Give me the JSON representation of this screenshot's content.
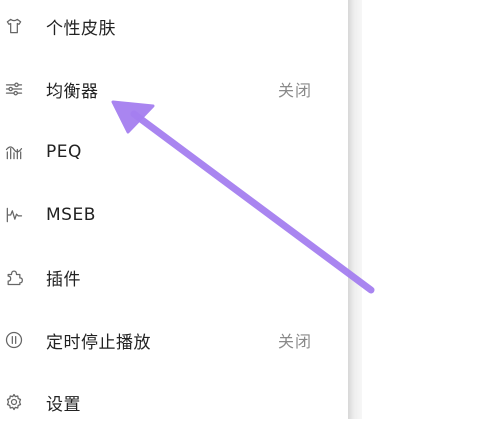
{
  "menu": {
    "items": [
      {
        "label": "个性皮肤",
        "status": "",
        "icon": "tshirt-icon"
      },
      {
        "label": "均衡器",
        "status": "关闭",
        "icon": "sliders-icon"
      },
      {
        "label": "PEQ",
        "status": "",
        "icon": "peq-bars-icon"
      },
      {
        "label": "MSEB",
        "status": "",
        "icon": "waveform-icon"
      },
      {
        "label": "插件",
        "status": "",
        "icon": "puzzle-icon"
      },
      {
        "label": "定时停止播放",
        "status": "关闭",
        "icon": "timer-icon"
      },
      {
        "label": "设置",
        "status": "",
        "icon": "gear-icon"
      }
    ]
  },
  "annotation": {
    "arrow_color": "#a57ff0",
    "points_to": "均衡器"
  }
}
